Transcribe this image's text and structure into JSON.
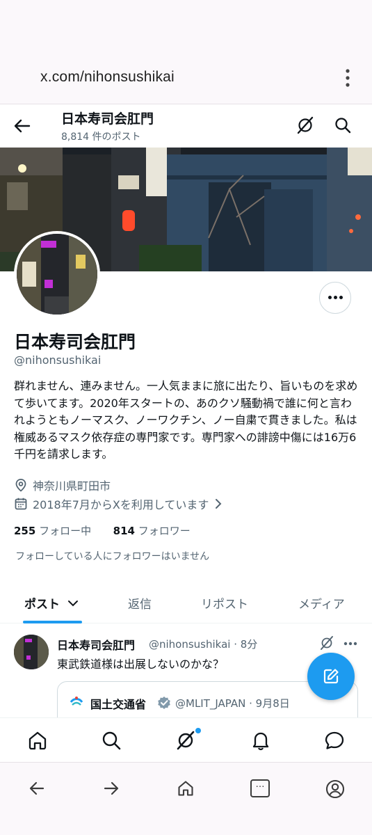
{
  "browser": {
    "url": "x.com/nihonsushikai",
    "menu_icon": "vertical-dots-icon",
    "nav": {
      "back_icon": "arrow-left-icon",
      "forward_icon": "arrow-right-icon",
      "home_icon": "home-icon",
      "tabs_icon": "tab-switcher-icon",
      "tabs_label": "…",
      "account_icon": "account-circle-icon"
    }
  },
  "header": {
    "title": "日本寿司会肛門",
    "post_count": "8,814 件のポスト",
    "icons": [
      "arrow-left-icon",
      "grok-icon",
      "search-icon"
    ]
  },
  "profile": {
    "display_name": "日本寿司会肛門",
    "handle": "@nihonsushikai",
    "bio": "群れません、連みません。一人気ままに旅に出たり、旨いものを求めて歩いてます。2020年スタートの、あのクソ騒動禍で誰に何と言われようともノーマスク、ノーワクチン、ノー自粛で貫きました。私は権威あるマスク依存症の専門家です。専門家への誹謗中傷には16万6千円を請求します。",
    "location": "神奈川県町田市",
    "joined": "2018年7月からXを利用しています",
    "following_count": "255",
    "following_label": "フォロー中",
    "followers_count": "814",
    "followers_label": "フォロワー",
    "followed_by": "フォローしている人にフォロワーはいません",
    "more_label": "•••"
  },
  "tabs": [
    {
      "label": "ポスト",
      "active": true
    },
    {
      "label": "返信",
      "active": false
    },
    {
      "label": "リポスト",
      "active": false
    },
    {
      "label": "メディア",
      "active": false
    }
  ],
  "tweet": {
    "author_name": "日本寿司会肛門",
    "author_handle_time": "@nihonsushikai · 8分",
    "text": "東武鉄道様は出展しないのかな？",
    "quote": {
      "name": "国土交通省",
      "handle_date": "@MLIT_JAPAN · 9月8日"
    }
  },
  "colors": {
    "accent": "#1d9bf0",
    "text_primary": "#0f1419",
    "text_secondary": "#536471",
    "secure_green": "#1e8e3e",
    "verified_gray": "#829aab"
  },
  "bottom_nav": [
    "home-icon",
    "search-icon",
    "grok-icon",
    "notifications-bell-icon",
    "messages-icon"
  ]
}
